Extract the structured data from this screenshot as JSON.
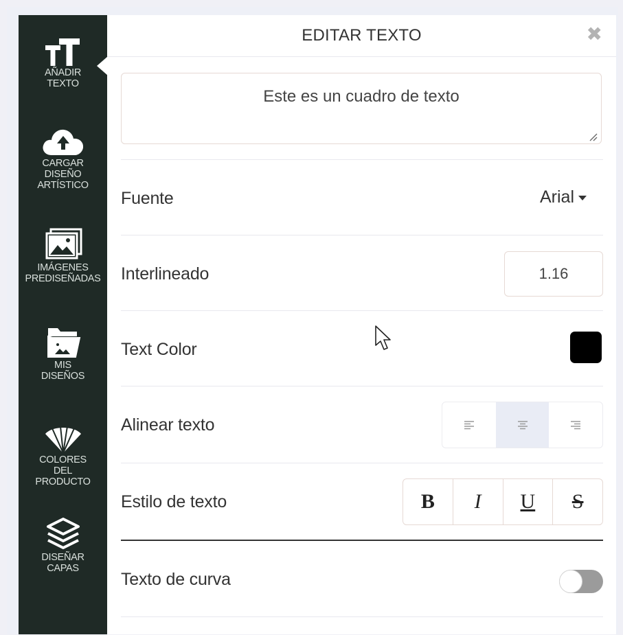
{
  "sidebar": {
    "items": [
      {
        "label": "AÑADIR\nTEXTO",
        "icon": "text-size-icon"
      },
      {
        "label": "CARGAR\nDISEÑO\nARTÍSTICO",
        "icon": "cloud-upload-icon"
      },
      {
        "label": "IMÁGENES\nPREDISEÑADAS",
        "icon": "images-icon"
      },
      {
        "label": "MIS\nDISEÑOS",
        "icon": "folder-image-icon"
      },
      {
        "label": "COLORES\nDEL\nPRODUCTO",
        "icon": "color-fan-icon"
      },
      {
        "label": "DISEÑAR\nCAPAS",
        "icon": "layers-icon"
      }
    ]
  },
  "panel": {
    "title": "EDITAR TEXTO",
    "close_glyph": "✖",
    "textbox_value": "Este es un cuadro de texto",
    "font_label": "Fuente",
    "font_value": "Arial",
    "line_height_label": "Interlineado",
    "line_height_value": "1.16",
    "text_color_label": "Text Color",
    "text_color": "#000000",
    "align_label": "Alinear texto",
    "align_selected": "center",
    "style_label": "Estilo de texto",
    "style_buttons": {
      "bold": "B",
      "italic": "I",
      "underline": "U",
      "strike": "S"
    },
    "curve_label": "Texto de curva",
    "curve_enabled": false
  },
  "colors": {
    "sidebar_bg": "#1f2a26",
    "accent_divider": "#333333"
  }
}
